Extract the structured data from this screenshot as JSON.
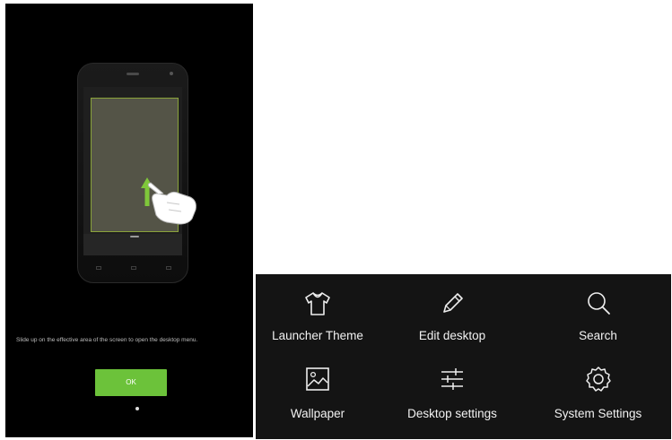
{
  "tutorial": {
    "instruction": "Slide up on the effective area of the screen to open the desktop menu.",
    "ok_label": "OK"
  },
  "menu": {
    "items": [
      {
        "label": "Launcher Theme",
        "icon": "tshirt-icon"
      },
      {
        "label": "Edit desktop",
        "icon": "pencil-icon"
      },
      {
        "label": "Search",
        "icon": "search-icon"
      },
      {
        "label": "Wallpaper",
        "icon": "picture-icon"
      },
      {
        "label": "Desktop settings",
        "icon": "sliders-icon"
      },
      {
        "label": "System Settings",
        "icon": "gear-icon"
      }
    ]
  },
  "colors": {
    "ok_button": "#6cc23a",
    "menu_background": "#141414",
    "tutorial_background": "#000000",
    "highlight_green": "#8aa33a"
  }
}
